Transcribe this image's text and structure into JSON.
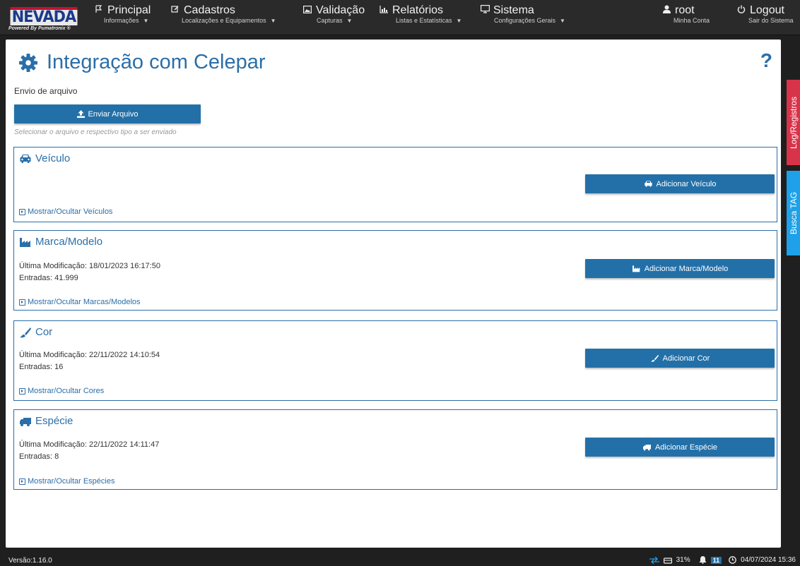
{
  "brand": {
    "logo_text": "NEVADA",
    "logo_sub": "Powered By Pumatronix ®"
  },
  "nav": {
    "principal": {
      "label": "Principal",
      "sub": "Informações"
    },
    "cadastros": {
      "label": "Cadastros",
      "sub": "Localizações e Equipamentos"
    },
    "validacao": {
      "label": "Validação",
      "sub": "Capturas"
    },
    "relatorios": {
      "label": "Relatórios",
      "sub": "Listas e Estatísticas"
    },
    "sistema": {
      "label": "Sistema",
      "sub": "Configurações Gerais"
    },
    "user": {
      "label": "root",
      "sub": "Minha Conta"
    },
    "logout": {
      "label": "Logout",
      "sub": "Sair do Sistema"
    }
  },
  "page": {
    "title": "Integração com Celepar",
    "help": "?",
    "envio_label": "Envio de arquivo",
    "enviar_button": "Enviar Arquivo",
    "helper_text": "Selecionar o arquivo e respectivo tipo a ser enviado"
  },
  "sections": {
    "veiculo": {
      "title": "Veículo",
      "add_button": "Adicionar Veículo",
      "toggle": "Mostrar/Ocultar Veículos"
    },
    "marca": {
      "title": "Marca/Modelo",
      "modified": "Última Modificação: 18/01/2023 16:17:50",
      "entries": "Entradas: 41.999",
      "add_button": "Adicionar Marca/Modelo",
      "toggle": "Mostrar/Ocultar Marcas/Modelos"
    },
    "cor": {
      "title": "Cor",
      "modified": "Última Modificação: 22/11/2022 14:10:54",
      "entries": "Entradas: 16",
      "add_button": "Adicionar Cor",
      "toggle": "Mostrar/Ocultar Cores"
    },
    "especie": {
      "title": "Espécie",
      "modified": "Última Modificação: 22/11/2022 14:11:47",
      "entries": "Entradas: 8",
      "add_button": "Adicionar Espécie",
      "toggle": "Mostrar/Ocultar Espécies"
    }
  },
  "side_tabs": {
    "log": "Log/Registros",
    "busca": "Busca TAG"
  },
  "footer": {
    "version": "Versão:1.16.0",
    "disk": "31%",
    "notifications": "11",
    "datetime": "04/07/2024 15:36"
  },
  "colors": {
    "accent": "#2b6ea8",
    "button": "#2370a8",
    "log_tab": "#d9334a",
    "busca_tab": "#1ea1e8"
  }
}
